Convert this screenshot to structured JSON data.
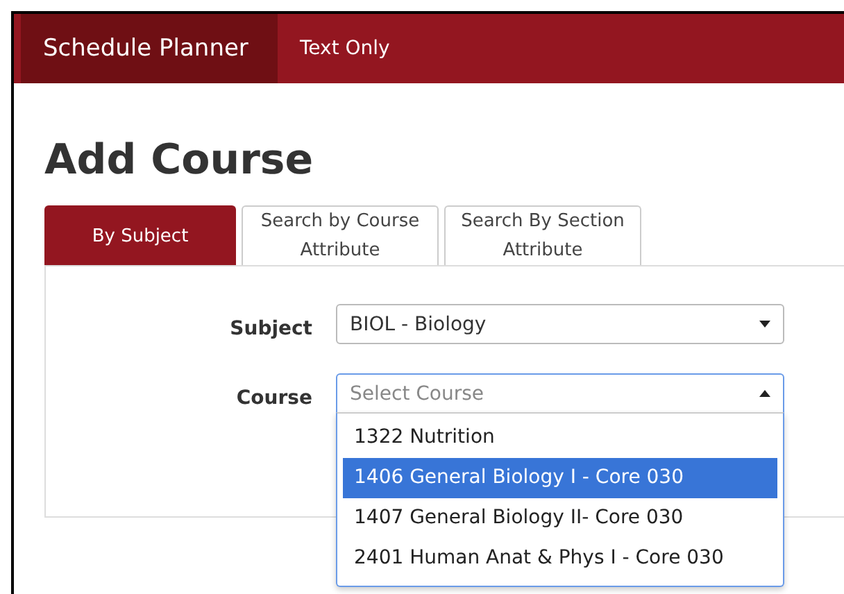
{
  "navbar": {
    "brand": "Schedule Planner",
    "links": [
      "Text Only"
    ]
  },
  "heading": "Add Course",
  "tabs": [
    {
      "label": "By Subject",
      "selected": true
    },
    {
      "label": "Search by Course Attribute",
      "selected": false
    },
    {
      "label": "Search By Section Attribute",
      "selected": false
    }
  ],
  "form": {
    "subject": {
      "label": "Subject",
      "value": "BIOL - Biology",
      "expanded": false
    },
    "course": {
      "label": "Course",
      "placeholder": "Select Course",
      "expanded": true,
      "options": [
        {
          "label": "1322 Nutrition",
          "selected": false
        },
        {
          "label": "1406 General Biology I - Core 030",
          "selected": true
        },
        {
          "label": "1407 General Biology II- Core 030",
          "selected": false
        },
        {
          "label": "2401 Human Anat & Phys I - Core 030",
          "selected": false
        }
      ]
    }
  }
}
